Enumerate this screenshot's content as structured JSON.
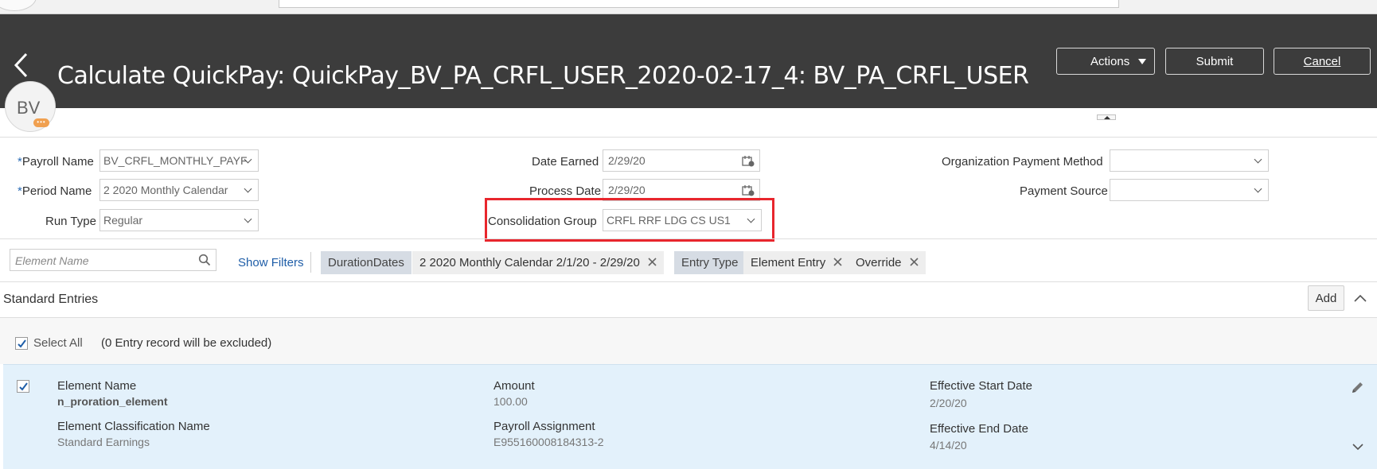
{
  "header": {
    "title": "Calculate QuickPay: QuickPay_BV_PA_CRFL_USER_2020-02-17_4: BV_PA_CRFL_USER",
    "actions_label": "Actions",
    "submit_label": "Submit",
    "cancel_label": "Cancel"
  },
  "avatar": {
    "initials": "BV",
    "badge": "•••"
  },
  "form": {
    "required_mark": "*",
    "payroll_name": {
      "label": "Payroll Name",
      "value": "BV_CRFL_MONTHLY_PAYF"
    },
    "period_name": {
      "label": "Period Name",
      "value": "2 2020 Monthly Calendar"
    },
    "run_type": {
      "label": "Run Type",
      "value": "Regular"
    },
    "date_earned": {
      "label": "Date Earned",
      "value": "2/29/20"
    },
    "process_date": {
      "label": "Process Date",
      "value": "2/29/20"
    },
    "consolidation_group": {
      "label": "Consolidation Group",
      "value": "CRFL RRF LDG CS US1"
    },
    "org_payment_method": {
      "label": "Organization Payment Method",
      "value": ""
    },
    "payment_source": {
      "label": "Payment Source",
      "value": ""
    }
  },
  "filters": {
    "search_placeholder": "Element Name",
    "show_filters": "Show Filters",
    "chips": [
      {
        "label": "DurationDates",
        "values": [
          "2 2020 Monthly Calendar 2/1/20 - 2/29/20"
        ]
      },
      {
        "label": "Entry Type",
        "values": [
          "Element Entry",
          "Override"
        ]
      }
    ]
  },
  "entries": {
    "section_title": "Standard Entries",
    "add_label": "Add",
    "select_all": "Select All",
    "excluded_note": "(0 Entry record will be excluded)",
    "items": [
      {
        "element_name_label": "Element Name",
        "element_name": "n_proration_element",
        "classification_label": "Element Classification Name",
        "classification": "Standard Earnings",
        "amount_label": "Amount",
        "amount": "100.00",
        "assignment_label": "Payroll Assignment",
        "assignment": "E955160008184313-2",
        "start_label": "Effective Start Date",
        "start": "2/20/20",
        "end_label": "Effective End Date",
        "end": "4/14/20"
      }
    ]
  },
  "colors": {
    "header_bg": "#3c3c3c",
    "highlight": "#e8262d",
    "link": "#1f5ea8",
    "entry_bg": "#e3f1fb",
    "checkbox": "#1f5ea8"
  }
}
